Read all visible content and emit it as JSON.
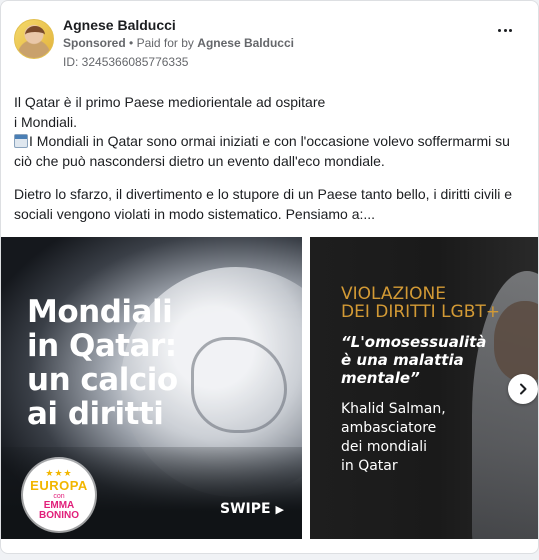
{
  "post": {
    "author": "Agnese Balducci",
    "sponsored": "Sponsored",
    "paid_for_prefix": "Paid for by",
    "paid_for_name": "Agnese Balducci",
    "separator": "•",
    "library_id": "ID: 3245366085776335"
  },
  "body": {
    "line1": "Il Qatar è il primo Paese mediorientale ad ospitare",
    "line2": "i Mondiali.",
    "line3": "I Mondiali in Qatar sono ormai iniziati e con l'occasione volevo soffermarmi su",
    "line4": "ciò che può nascondersi dietro un evento dall'eco mondiale.",
    "line5": "Dietro lo sfarzo, il divertimento e lo stupore di un Paese tanto bello, i diritti civili e",
    "line6": "sociali vengono violati in modo sistematico. Pensiamo a:..."
  },
  "carousel": {
    "slide1": {
      "headline": [
        "Mondiali",
        "in Qatar:",
        "un calcio",
        "ai diritti"
      ],
      "logo_top": "EUROPA",
      "logo_mid": "con",
      "logo_bottom_1": "EMMA",
      "logo_bottom_2": "BONINO",
      "swipe_label": "SWIPE"
    },
    "slide2": {
      "title_line1": "VIOLAZIONE",
      "title_line2": "DEI DIRITTI LGBT+",
      "quote": [
        "“L'omosessualità",
        "è una malattia",
        "mentale”"
      ],
      "attribution": [
        "Khalid Salman,",
        "ambasciatore",
        "dei mondiali",
        "in Qatar"
      ]
    }
  },
  "colors": {
    "accent_gold": "#d39a35",
    "text_primary": "#1c1e21",
    "text_secondary": "#65676b",
    "europa_yellow": "#f2b600",
    "bonino_pink": "#e11f7a"
  },
  "icons": {
    "more": "more-horizontal-icon",
    "calendar": "calendar-emoji-icon",
    "next": "chevron-right-icon",
    "swipe_arrow": "play-arrow-icon"
  }
}
